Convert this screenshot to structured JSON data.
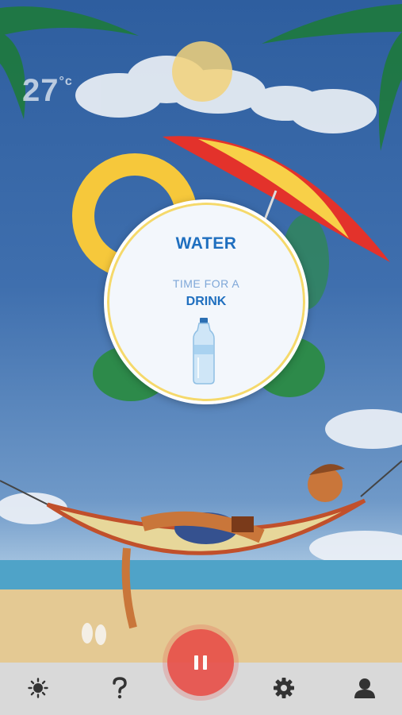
{
  "weather": {
    "temperature": "27",
    "unit": "°c"
  },
  "reminder": {
    "title": "WATER",
    "subtitle": "TIME FOR A",
    "action": "DRINK"
  },
  "nav": {
    "items": [
      "sun-icon",
      "help-icon",
      "pause-icon",
      "gear-icon",
      "user-icon"
    ]
  },
  "colors": {
    "accent": "#1f6fbf",
    "pause": "#e8514a",
    "navbar": "#d9d9d9"
  }
}
